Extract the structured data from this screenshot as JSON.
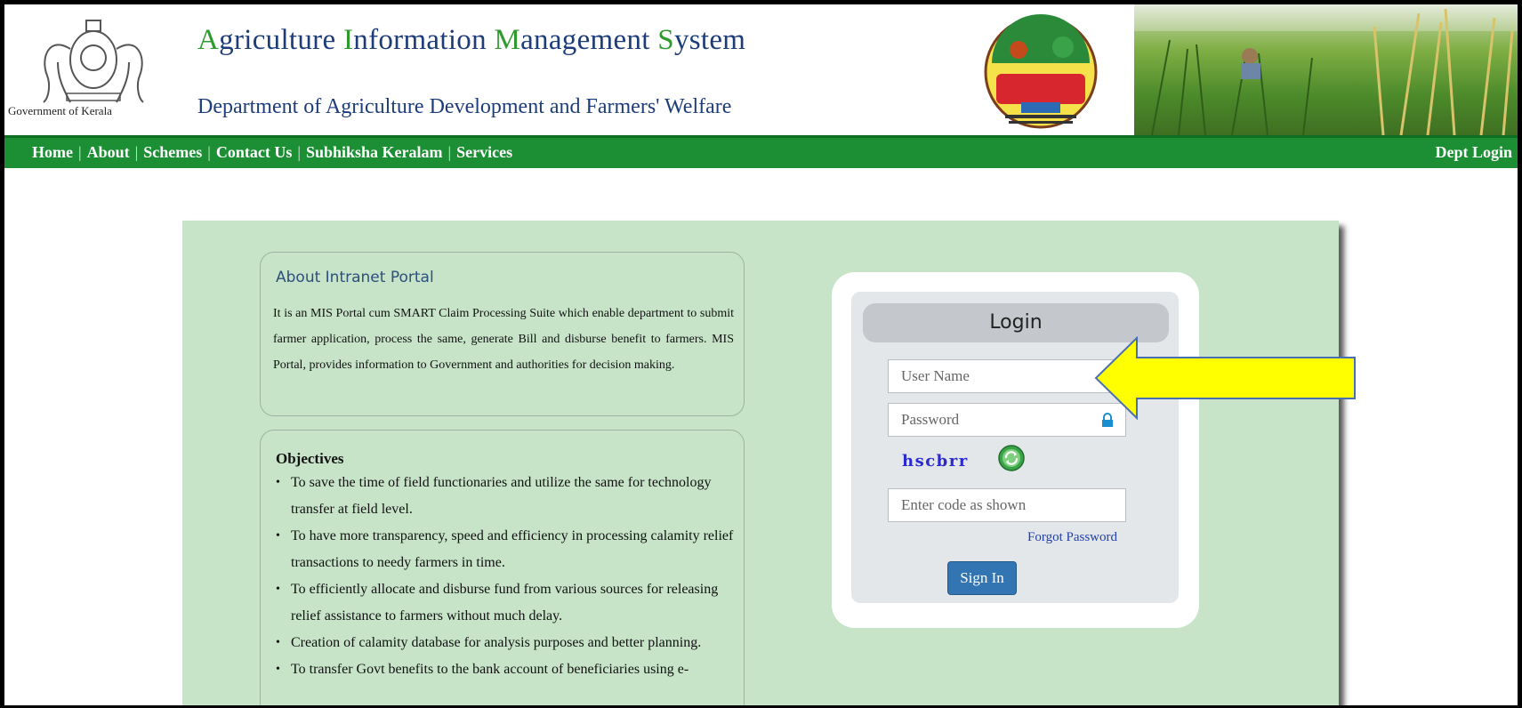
{
  "header": {
    "emblem_label": "Government of Kerala",
    "title_parts": [
      {
        "text": "A",
        "accent": true
      },
      {
        "text": "griculture ",
        "accent": false
      },
      {
        "text": "I",
        "accent": true
      },
      {
        "text": "nformation ",
        "accent": false
      },
      {
        "text": "M",
        "accent": true
      },
      {
        "text": "anagement ",
        "accent": false
      },
      {
        "text": "S",
        "accent": true
      },
      {
        "text": "ystem",
        "accent": false
      }
    ],
    "subtitle": "Department of Agriculture Development and Farmers' Welfare",
    "logo_icon": "subhiksha-keralam-logo",
    "banner_icon": "paddy-field-photo"
  },
  "nav": {
    "items": [
      "Home",
      "About",
      "Schemes",
      "Contact Us",
      "Subhiksha Keralam",
      "Services"
    ],
    "right": "Dept Login"
  },
  "about": {
    "title": "About Intranet Portal",
    "text": "It is an MIS Portal cum SMART Claim Processing Suite which enable department to submit farmer application, process the same, generate Bill and disburse benefit to farmers. MIS Portal, provides information to Government and authorities for decision making."
  },
  "objectives": {
    "title": "Objectives",
    "items": [
      "To save the time of field functionaries and utilize the same for technology transfer at field level.",
      "To have more transparency, speed and efficiency in processing calamity relief transactions to needy farmers in time.",
      "To efficiently allocate and disburse fund from various sources for releasing relief assistance to farmers without much delay.",
      "Creation of calamity database for analysis purposes and better planning.",
      "To transfer Govt benefits to the bank account of beneficiaries using e-"
    ]
  },
  "login": {
    "title": "Login",
    "username_placeholder": "User Name",
    "password_placeholder": "Password",
    "captcha": "hscbrr",
    "captcha_placeholder": "Enter code as shown",
    "forgot": "Forgot Password",
    "signin": "Sign In",
    "username_icon": "user-icon",
    "password_icon": "lock-icon",
    "refresh_icon": "refresh-captcha-icon"
  },
  "colors": {
    "nav_green": "#1c8f35",
    "panel_green": "#c7e4c9",
    "title_blue": "#1d3c7a",
    "title_accent": "#2e9a2e",
    "signin_blue": "#3375b2",
    "arrow_yellow": "#ffff00",
    "icon_blue": "#1a8fd0"
  },
  "annotation": {
    "arrow_icon": "arrow-left-icon"
  }
}
